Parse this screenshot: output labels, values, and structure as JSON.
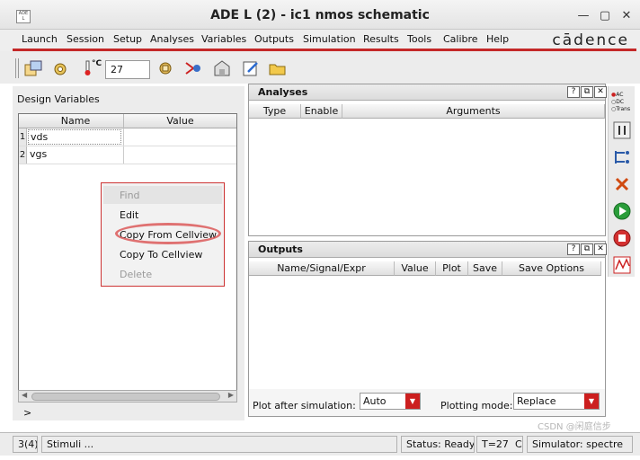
{
  "window": {
    "title": "ADE L (2) - ic1 nmos schematic",
    "app_icon_text": "ADE L",
    "minimize_glyph": "—",
    "maximize_glyph": "▢",
    "close_glyph": "✕"
  },
  "menu": {
    "items": [
      "Launch",
      "Session",
      "Setup",
      "Analyses",
      "Variables",
      "Outputs",
      "Simulation",
      "Results",
      "Tools",
      "Calibre",
      "Help"
    ],
    "brand": "cādence"
  },
  "toolbar": {
    "temperature_unit": "°C",
    "temperature_value": "27"
  },
  "design_variables": {
    "label": "Design Variables",
    "columns": [
      "Name",
      "Value"
    ],
    "rows": [
      {
        "num": "1",
        "name": "vds",
        "value": ""
      },
      {
        "num": "2",
        "name": "vgs",
        "value": ""
      }
    ],
    "prompt": ">"
  },
  "context_menu": {
    "items": [
      {
        "label": "Find",
        "enabled": false
      },
      {
        "label": "Edit",
        "enabled": true
      },
      {
        "label": "Copy From Cellview",
        "enabled": true,
        "highlighted": true
      },
      {
        "label": "Copy To Cellview",
        "enabled": true
      },
      {
        "label": "Delete",
        "enabled": false
      }
    ]
  },
  "analyses": {
    "title": "Analyses",
    "columns": [
      "Type",
      "Enable",
      "Arguments"
    ]
  },
  "outputs": {
    "title": "Outputs",
    "columns": [
      "Name/Signal/Expr",
      "Value",
      "Plot",
      "Save",
      "Save Options"
    ],
    "plot_after_label": "Plot after simulation:",
    "plot_after_value": "Auto",
    "plotting_mode_label": "Plotting mode:",
    "plotting_mode_value": "Replace"
  },
  "panel_buttons": {
    "help": "?",
    "float": "⧉",
    "close": "✕"
  },
  "right_toolbar": {
    "analysis_options": [
      "AC",
      "DC",
      "Trans"
    ]
  },
  "status": {
    "history": "3(4)",
    "stimuli": "Stimuli ...",
    "status": "Status: Ready",
    "temp": "T=27",
    "unit": "C",
    "simulator": "Simulator: spectre"
  },
  "watermark": "CSDN @闲庭信步",
  "colors": {
    "accent_red": "#c42828",
    "run_green": "#2a9d3a",
    "stop_red": "#d33030"
  }
}
